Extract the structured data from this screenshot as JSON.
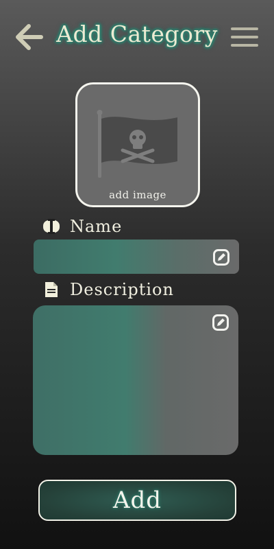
{
  "header": {
    "title": "Add Category",
    "back_icon": "arrow-left-icon",
    "menu_icon": "hamburger-menu-icon"
  },
  "image_picker": {
    "caption": "add image",
    "placeholder_icon": "pirate-flag-icon"
  },
  "name": {
    "label": "Name",
    "label_icon": "text-cursor-icon",
    "value": "",
    "edit_icon": "edit-icon"
  },
  "description": {
    "label": "Description",
    "label_icon": "document-icon",
    "value": "",
    "edit_icon": "edit-icon"
  },
  "submit": {
    "label": "Add"
  },
  "colors": {
    "accent": "#2f7d6c",
    "title_text": "#ecebd3",
    "button_bg": "#254139"
  }
}
